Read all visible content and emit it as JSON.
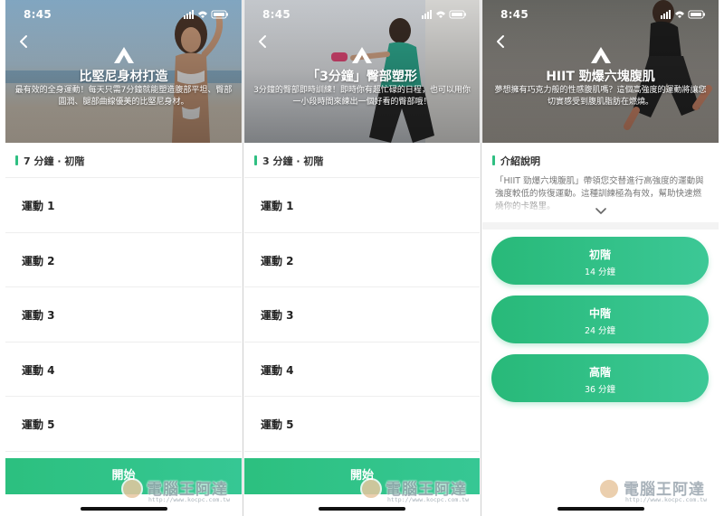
{
  "status": {
    "time": "8:45"
  },
  "screens": [
    {
      "title": "比堅尼身材打造",
      "description": "最有效的全身運動！每天只需7分鐘就能塑造腹部平坦、臀部圓潤、腿部曲線優美的比堅尼身材。",
      "section": "7 分鐘 · 初階",
      "exercises": [
        "運動 1",
        "運動 2",
        "運動 3",
        "運動 4",
        "運動 5"
      ],
      "start": "開始"
    },
    {
      "title": "「3分鐘」臀部塑形",
      "description": "3分鐘的臀部即時訓練！即時你有超忙碌的日程，也可以用你一小段時間來練出一個好看的臀部哦！",
      "section": "3 分鐘 · 初階",
      "exercises": [
        "運動 1",
        "運動 2",
        "運動 3",
        "運動 4",
        "運動 5"
      ],
      "start": "開始"
    },
    {
      "title": "HIIT 勁爆六塊腹肌",
      "description": "夢想擁有巧克力般的性感腹肌嗎？這個高強度的運動將讓您切實感受到腹肌脂肪在燃燒。",
      "section": "介紹說明",
      "intro": "「HIIT 勁爆六塊腹肌」帶領您交替進行高強度的運動與強度較低的恢復運動。這種訓練極為有效，幫助快速燃燒你的卡路里。",
      "levels": [
        {
          "name": "初階",
          "duration": "14 分鐘"
        },
        {
          "name": "中階",
          "duration": "24 分鐘"
        },
        {
          "name": "高階",
          "duration": "36 分鐘"
        }
      ]
    }
  ],
  "watermark": {
    "text": "電腦王阿達",
    "url": "http://www.kocpc.com.tw"
  },
  "colors": {
    "accent": "#2fbf82",
    "button": "#2cc07f"
  }
}
